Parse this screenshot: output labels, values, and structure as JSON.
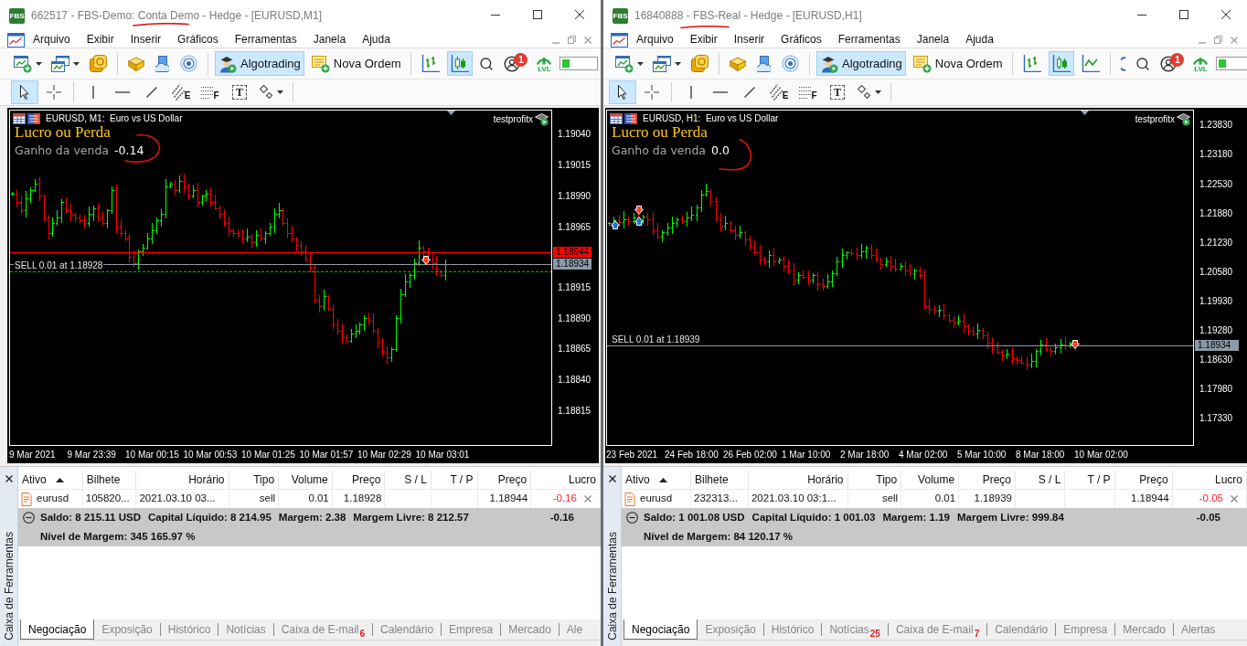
{
  "windows": [
    {
      "logo": "FBS",
      "title": "662517 - FBS-Demo: Conta Demo - Hedge - [EURUSD,M1]",
      "menu": [
        "Arquivo",
        "Exibir",
        "Inserir",
        "Gráficos",
        "Ferramentas",
        "Janela",
        "Ajuda"
      ],
      "toolbar": [
        {
          "kind": "new_chart",
          "selected": false
        },
        {
          "kind": "profiles",
          "selected": false
        },
        {
          "kind": "coins",
          "selected": false
        },
        {
          "kind": "separator"
        },
        {
          "kind": "book",
          "selected": false
        },
        {
          "kind": "cloud",
          "selected": false
        },
        {
          "kind": "signals",
          "selected": false
        },
        {
          "kind": "separator"
        },
        {
          "kind": "algotrading",
          "label": "Algotrading",
          "selected": true
        },
        {
          "kind": "new_order",
          "label": "Nova Ordem",
          "selected": false
        },
        {
          "kind": "separator"
        },
        {
          "kind": "bar_chart",
          "selected": false
        },
        {
          "kind": "candle_chart",
          "selected": true
        }
      ],
      "status": {
        "notifications": "1",
        "lvl_label": "LVL",
        "level": 0.2
      },
      "drawing_tools": [
        {
          "kind": "cursor",
          "selected": true
        },
        {
          "kind": "crosshair",
          "selected": false
        },
        {
          "kind": "separator"
        },
        {
          "kind": "vertical_line",
          "selected": false
        },
        {
          "kind": "horizontal_line",
          "selected": false
        },
        {
          "kind": "trend_line",
          "selected": false
        },
        {
          "kind": "channel",
          "letter": "E",
          "selected": false
        },
        {
          "kind": "fibonacci",
          "letter": "F",
          "selected": false
        },
        {
          "kind": "text",
          "letter": "T",
          "selected": false
        },
        {
          "kind": "shapes",
          "selected": false
        }
      ],
      "chart": {
        "symbol": "EURUSD, M1:  Euro vs US Dollar",
        "expert": "testprofitx",
        "heading": "Lucro ou Perda",
        "label": "Ganho da venda",
        "value": "-0.14",
        "price_axis": [
          "1.19040",
          "1.19015",
          "1.18990",
          "1.18965",
          "1.18915",
          "1.18890",
          "1.18865",
          "1.18840",
          "1.18815"
        ],
        "time_axis": [
          "9 Mar 2021",
          "9 Mar 23:39",
          "10 Mar 00:15",
          "10 Mar 00:53",
          "10 Mar 01:25",
          "10 Mar 01:57",
          "10 Mar 02:29",
          "10 Mar 03:01"
        ],
        "price_tags": [
          {
            "label": "1.18944",
            "color": "#ff0000"
          },
          {
            "label": "1.18934",
            "color": "#8c9aa8"
          }
        ],
        "order": {
          "label": "SELL 0.01 at 1.18928",
          "dashed_line": true
        }
      },
      "toolbox": {
        "side_label": "Caixa de Ferramentas",
        "columns": [
          {
            "label": "Ativo",
            "sorted": true
          },
          {
            "label": "Bilhete",
            "sorted": false
          },
          {
            "label": "Horário",
            "sorted": false
          },
          {
            "label": "Tipo",
            "sorted": false
          },
          {
            "label": "Volume",
            "sorted": false
          },
          {
            "label": "Preço",
            "sorted": false
          },
          {
            "label": "S / L",
            "sorted": false
          },
          {
            "label": "T / P",
            "sorted": false
          },
          {
            "label": "Preço",
            "sorted": false
          },
          {
            "label": "Lucro",
            "sorted": false
          }
        ],
        "rows": [
          {
            "asset": "eurusd",
            "ticket": "105820...",
            "time": "2021.03.10 03...",
            "type": "sell",
            "volume": "0.01",
            "open_price": "1.18928",
            "current_price": "1.18944",
            "profit": "-0.16",
            "loss": true
          }
        ],
        "summary": {
          "expanded": true,
          "items": [
            "Saldo: 8 215.11 USD",
            "Capital Líquido: 8 214.95",
            "Margem: 2.38",
            "Margem Livre: 8 212.57"
          ],
          "total": "-0.16",
          "margin_level": "Nível de Margem: 345 165.97 %"
        },
        "tabs": [
          {
            "label": "Negociação",
            "selected": true
          },
          {
            "label": "Exposição",
            "selected": false
          },
          {
            "label": "Histórico",
            "selected": false
          },
          {
            "label": "Notícias",
            "selected": false
          },
          {
            "label": "Caixa de E-mail",
            "badge": "6",
            "selected": false
          },
          {
            "label": "Calendário",
            "selected": false
          },
          {
            "label": "Empresa",
            "selected": false
          },
          {
            "label": "Mercado",
            "selected": false
          },
          {
            "label": "Ale",
            "selected": false
          }
        ]
      }
    },
    {
      "logo": "FBS",
      "title": "16840888 - FBS-Real - Hedge - [EURUSD,H1]",
      "menu": [
        "Arquivo",
        "Exibir",
        "Inserir",
        "Gráficos",
        "Ferramentas",
        "Janela",
        "Ajuda"
      ],
      "toolbar": [
        {
          "kind": "new_chart",
          "selected": false
        },
        {
          "kind": "profiles",
          "selected": false
        },
        {
          "kind": "coins",
          "selected": false
        },
        {
          "kind": "separator"
        },
        {
          "kind": "book",
          "selected": false
        },
        {
          "kind": "cloud",
          "selected": false
        },
        {
          "kind": "signals",
          "selected": false
        },
        {
          "kind": "separator"
        },
        {
          "kind": "algotrading",
          "label": "Algotrading",
          "selected": true
        },
        {
          "kind": "new_order",
          "label": "Nova Ordem",
          "selected": false
        },
        {
          "kind": "separator"
        },
        {
          "kind": "bar_chart",
          "selected": false
        },
        {
          "kind": "candle_chart",
          "selected": true
        },
        {
          "kind": "line_chart",
          "selected": false
        },
        {
          "kind": "separator"
        },
        {
          "kind": "clipped",
          "selected": false
        }
      ],
      "status": {
        "notifications": "1",
        "lvl_label": "LVL",
        "level": 0.2
      },
      "drawing_tools": [
        {
          "kind": "cursor",
          "selected": true
        },
        {
          "kind": "crosshair",
          "selected": false
        },
        {
          "kind": "separator"
        },
        {
          "kind": "vertical_line",
          "selected": false
        },
        {
          "kind": "horizontal_line",
          "selected": false
        },
        {
          "kind": "trend_line",
          "selected": false
        },
        {
          "kind": "channel",
          "letter": "E",
          "selected": false
        },
        {
          "kind": "fibonacci",
          "letter": "F",
          "selected": false
        },
        {
          "kind": "text",
          "letter": "T",
          "selected": false
        },
        {
          "kind": "shapes",
          "selected": false
        }
      ],
      "chart": {
        "symbol": "EURUSD, H1:  Euro vs US Dollar",
        "expert": "testprofitx",
        "heading": "Lucro ou Perda",
        "label": "Ganho da venda",
        "value": "0.0",
        "price_axis": [
          "1.23830",
          "1.23180",
          "1.22530",
          "1.21880",
          "1.21230",
          "1.20580",
          "1.19930",
          "1.19280",
          "1.18630",
          "1.17980",
          "1.17330"
        ],
        "time_axis": [
          "23 Feb 2021",
          "24 Feb 18:00",
          "26 Feb 02:00",
          "1 Mar 10:00",
          "2 Mar 18:00",
          "4 Mar 02:00",
          "5 Mar 10:00",
          "8 Mar 18:00",
          "10 Mar 02:00"
        ],
        "price_tags": [
          {
            "label": "1.18934",
            "color": "#8c9aa8"
          }
        ],
        "order": {
          "label": "SELL 0.01 at 1.18939",
          "dashed_line": false
        }
      },
      "toolbox": {
        "side_label": "Caixa de Ferramentas",
        "columns": [
          {
            "label": "Ativo",
            "sorted": true
          },
          {
            "label": "Bilhete",
            "sorted": false
          },
          {
            "label": "Horário",
            "sorted": false
          },
          {
            "label": "Tipo",
            "sorted": false
          },
          {
            "label": "Volume",
            "sorted": false
          },
          {
            "label": "Preço",
            "sorted": false
          },
          {
            "label": "S / L",
            "sorted": false
          },
          {
            "label": "T / P",
            "sorted": false
          },
          {
            "label": "Preço",
            "sorted": false
          },
          {
            "label": "Lucro",
            "sorted": false
          }
        ],
        "rows": [
          {
            "asset": "eurusd",
            "ticket": "232313...",
            "time": "2021.03.10 03:1...",
            "type": "sell",
            "volume": "0.01",
            "open_price": "1.18939",
            "current_price": "1.18944",
            "profit": "-0.05",
            "loss": true
          }
        ],
        "summary": {
          "expanded": true,
          "items": [
            "Saldo: 1 001.08 USD",
            "Capital Líquido: 1 001.03",
            "Margem: 1.19",
            "Margem Livre: 999.84"
          ],
          "total": "-0.05",
          "margin_level": "Nível de Margem: 84 120.17 %"
        },
        "tabs": [
          {
            "label": "Negociação",
            "selected": true
          },
          {
            "label": "Exposição",
            "selected": false
          },
          {
            "label": "Histórico",
            "selected": false
          },
          {
            "label": "Notícias",
            "badge": "25",
            "selected": false
          },
          {
            "label": "Caixa de E-mail",
            "badge": "7",
            "selected": false
          },
          {
            "label": "Calendário",
            "selected": false
          },
          {
            "label": "Empresa",
            "selected": false
          },
          {
            "label": "Mercado",
            "selected": false
          },
          {
            "label": "Alertas",
            "selected": false
          }
        ]
      }
    }
  ]
}
